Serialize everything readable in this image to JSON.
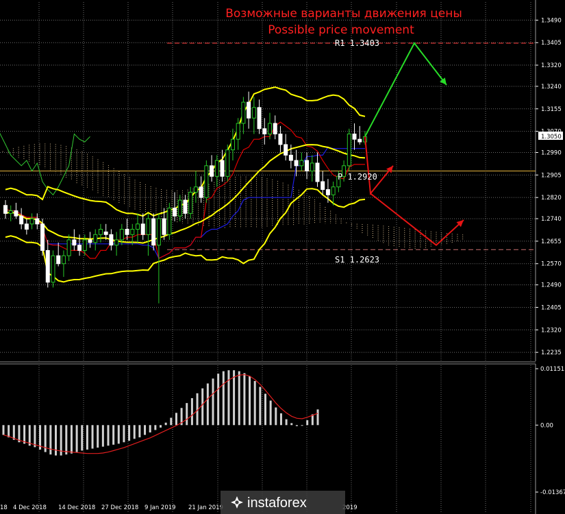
{
  "title_ru": "Возможные варианты движения цены",
  "title_en": "Possible price movement",
  "current_price": "1.3050",
  "levels": [
    {
      "id": "r1",
      "label": "R1  1.3403",
      "value": 1.3403,
      "color": "#ff3c3c",
      "style": "dash"
    },
    {
      "id": "p",
      "label": "P  1.2920",
      "value": 1.292,
      "color": "#e6b43c",
      "style": "solid"
    },
    {
      "id": "s1",
      "label": "S1  1.2623",
      "value": 1.2623,
      "color": "#c86e6e",
      "style": "dash"
    }
  ],
  "watermark": "instaforex",
  "colors": {
    "background": "#000000",
    "grid": "#6e6e6e",
    "bull_candle": "#28c828",
    "bear_candle": "#ffffff",
    "bollinger": "#ffff00",
    "tenkan": "#e00000",
    "kijun": "#1e1ee6",
    "chikou": "#32c832",
    "cloud": "#f0d2a0",
    "macd_hist": "#d2d2d2",
    "macd_signal": "#e01e1e",
    "arrow_up": "#28dc28",
    "arrow_down": "#e61414"
  },
  "chart_data": [
    {
      "type": "candlestick",
      "panel": "price",
      "ylim": [
        1.2225,
        1.3535
      ],
      "y_ticks": [
        "1.3490",
        "1.3405",
        "1.3320",
        "1.3240",
        "1.3155",
        "1.3070",
        "1.2990",
        "1.2905",
        "1.2820",
        "1.2740",
        "1.2655",
        "1.2570",
        "1.2490",
        "1.2405",
        "1.2320",
        "1.2235"
      ],
      "x_labels": [
        "18",
        "4 Dec 2018",
        "14 Dec 2018",
        "27 Dec 2018",
        "9 Jan 2019",
        "21 Jan 2019",
        "2019"
      ],
      "ohlc": [
        [
          1.279,
          1.281,
          1.274,
          1.276
        ],
        [
          1.276,
          1.279,
          1.273,
          1.277
        ],
        [
          1.277,
          1.28,
          1.274,
          1.275
        ],
        [
          1.275,
          1.278,
          1.27,
          1.272
        ],
        [
          1.272,
          1.274,
          1.268,
          1.27
        ],
        [
          1.272,
          1.276,
          1.27,
          1.274
        ],
        [
          1.274,
          1.276,
          1.27,
          1.272
        ],
        [
          1.272,
          1.274,
          1.26,
          1.262
        ],
        [
          1.262,
          1.266,
          1.248,
          1.25
        ],
        [
          1.25,
          1.262,
          1.248,
          1.26
        ],
        [
          1.26,
          1.265,
          1.256,
          1.257
        ],
        [
          1.257,
          1.262,
          1.252,
          1.26
        ],
        [
          1.26,
          1.268,
          1.258,
          1.266
        ],
        [
          1.266,
          1.27,
          1.262,
          1.264
        ],
        [
          1.264,
          1.268,
          1.26,
          1.262
        ],
        [
          1.262,
          1.268,
          1.26,
          1.266
        ],
        [
          1.266,
          1.269,
          1.263,
          1.265
        ],
        [
          1.265,
          1.27,
          1.262,
          1.268
        ],
        [
          1.268,
          1.272,
          1.265,
          1.27
        ],
        [
          1.269,
          1.272,
          1.266,
          1.268
        ],
        [
          1.268,
          1.27,
          1.262,
          1.264
        ],
        [
          1.264,
          1.269,
          1.26,
          1.266
        ],
        [
          1.266,
          1.272,
          1.264,
          1.27
        ],
        [
          1.27,
          1.274,
          1.266,
          1.268
        ],
        [
          1.268,
          1.272,
          1.264,
          1.27
        ],
        [
          1.27,
          1.276,
          1.265,
          1.272
        ],
        [
          1.272,
          1.276,
          1.266,
          1.268
        ],
        [
          1.268,
          1.276,
          1.26,
          1.274
        ],
        [
          1.274,
          1.276,
          1.262,
          1.264
        ],
        [
          1.264,
          1.276,
          1.242,
          1.274
        ],
        [
          1.274,
          1.278,
          1.266,
          1.268
        ],
        [
          1.268,
          1.28,
          1.266,
          1.278
        ],
        [
          1.278,
          1.284,
          1.273,
          1.275
        ],
        [
          1.275,
          1.283,
          1.273,
          1.281
        ],
        [
          1.281,
          1.283,
          1.274,
          1.276
        ],
        [
          1.276,
          1.286,
          1.274,
          1.284
        ],
        [
          1.284,
          1.292,
          1.28,
          1.286
        ],
        [
          1.286,
          1.29,
          1.28,
          1.282
        ],
        [
          1.282,
          1.296,
          1.28,
          1.294
        ],
        [
          1.294,
          1.298,
          1.288,
          1.29
        ],
        [
          1.29,
          1.298,
          1.286,
          1.296
        ],
        [
          1.296,
          1.3,
          1.288,
          1.29
        ],
        [
          1.29,
          1.302,
          1.288,
          1.3
        ],
        [
          1.3,
          1.308,
          1.296,
          1.304
        ],
        [
          1.304,
          1.312,
          1.3,
          1.31
        ],
        [
          1.31,
          1.32,
          1.306,
          1.318
        ],
        [
          1.318,
          1.322,
          1.308,
          1.312
        ],
        [
          1.312,
          1.32,
          1.306,
          1.316
        ],
        [
          1.316,
          1.319,
          1.306,
          1.308
        ],
        [
          1.308,
          1.312,
          1.302,
          1.306
        ],
        [
          1.306,
          1.314,
          1.304,
          1.31
        ],
        [
          1.31,
          1.313,
          1.304,
          1.306
        ],
        [
          1.306,
          1.309,
          1.299,
          1.302
        ],
        [
          1.302,
          1.306,
          1.296,
          1.298
        ],
        [
          1.298,
          1.302,
          1.293,
          1.296
        ],
        [
          1.296,
          1.3,
          1.29,
          1.294
        ],
        [
          1.294,
          1.299,
          1.292,
          1.296
        ],
        [
          1.296,
          1.299,
          1.289,
          1.292
        ],
        [
          1.292,
          1.298,
          1.288,
          1.295
        ],
        [
          1.295,
          1.299,
          1.286,
          1.288
        ],
        [
          1.288,
          1.292,
          1.283,
          1.285
        ],
        [
          1.285,
          1.289,
          1.28,
          1.283
        ],
        [
          1.283,
          1.288,
          1.279,
          1.286
        ],
        [
          1.286,
          1.292,
          1.284,
          1.29
        ],
        [
          1.29,
          1.296,
          1.288,
          1.294
        ],
        [
          1.294,
          1.308,
          1.292,
          1.306
        ],
        [
          1.306,
          1.31,
          1.3,
          1.304
        ],
        [
          1.304,
          1.309,
          1.302,
          1.303
        ],
        [
          1.303,
          1.307,
          1.302,
          1.305
        ]
      ]
    },
    {
      "type": "bar",
      "panel": "macd",
      "ylim": [
        -0.01367,
        0.01151
      ],
      "y_ticks": [
        "0.01151",
        "0.00",
        "-0.01367"
      ],
      "histogram": [
        -0.002,
        -0.0025,
        -0.003,
        -0.0035,
        -0.0038,
        -0.0042,
        -0.0045,
        -0.005,
        -0.0055,
        -0.006,
        -0.0062,
        -0.0062,
        -0.006,
        -0.0058,
        -0.0055,
        -0.0052,
        -0.005,
        -0.0048,
        -0.0046,
        -0.0044,
        -0.0042,
        -0.004,
        -0.0038,
        -0.0035,
        -0.0032,
        -0.0028,
        -0.0025,
        -0.002,
        -0.0015,
        -0.001,
        -0.0005,
        0.0005,
        0.0015,
        0.0025,
        0.0035,
        0.0045,
        0.0055,
        0.0065,
        0.0075,
        0.0085,
        0.0095,
        0.0105,
        0.011,
        0.0112,
        0.0112,
        0.011,
        0.0106,
        0.01,
        0.009,
        0.0078,
        0.0064,
        0.005,
        0.0036,
        0.0024,
        0.0012,
        0.0004,
        -0.0002,
        0.0,
        0.001,
        0.0022,
        0.0032
      ],
      "signal": [
        -0.002,
        -0.0023,
        -0.0027,
        -0.0031,
        -0.0034,
        -0.0037,
        -0.004,
        -0.0043,
        -0.0046,
        -0.0049,
        -0.0051,
        -0.0053,
        -0.0054,
        -0.0055,
        -0.0056,
        -0.0057,
        -0.0058,
        -0.0058,
        -0.0058,
        -0.0057,
        -0.0055,
        -0.0052,
        -0.0049,
        -0.0046,
        -0.0042,
        -0.0038,
        -0.0034,
        -0.003,
        -0.0026,
        -0.0021,
        -0.0016,
        -0.0011,
        -0.0006,
        -0.0001,
        0.0005,
        0.0012,
        0.002,
        0.003,
        0.0042,
        0.0054,
        0.0064,
        0.0074,
        0.0084,
        0.0092,
        0.0098,
        0.0102,
        0.0103,
        0.01,
        0.0093,
        0.0083,
        0.0071,
        0.0058,
        0.0045,
        0.0034,
        0.0025,
        0.0018,
        0.0014,
        0.0013,
        0.0016,
        0.002,
        0.0024
      ]
    }
  ]
}
